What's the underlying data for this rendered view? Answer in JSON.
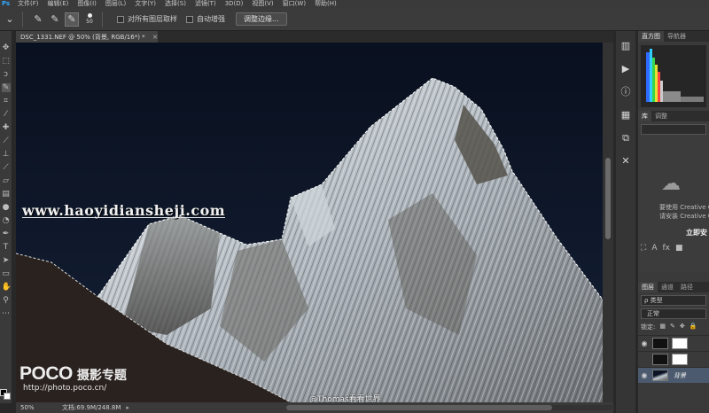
{
  "menubar": {
    "app_logo": "Ps",
    "items": [
      "文件(F)",
      "编辑(E)",
      "图像(I)",
      "图层(L)",
      "文字(Y)",
      "选择(S)",
      "滤镜(T)",
      "3D(D)",
      "视图(V)",
      "窗口(W)",
      "帮助(H)"
    ]
  },
  "options": {
    "brush_size": "50",
    "sample_all_layers": "对所有图层取样",
    "auto_enhance": "自动增强",
    "refine_edge": "调整边缘..."
  },
  "document": {
    "tab_title": "DSC_1331.NEF @ 50% (背景, RGB/16*) *",
    "close": "×"
  },
  "canvas": {
    "watermark_url": "www.haoyidiansheji.com",
    "logo_brand": "POCO",
    "logo_section": "摄影专题",
    "logo_url": "http://photo.poco.cn/",
    "credit": "@Thomas看看世界"
  },
  "status": {
    "zoom": "50%",
    "doc_size": "文档:69.9M/248.8M",
    "arrow": "▸"
  },
  "dock_icons": [
    "histogram-dock-icon",
    "play-icon",
    "info-icon",
    "brush-preset-icon",
    "clone-source-icon",
    "tool-preset-icon"
  ],
  "panels": {
    "top_tabs": [
      "直方图",
      "导航器"
    ],
    "library_tabs": [
      "库",
      "调整"
    ],
    "cc_line1": "要使用 Creative C",
    "cc_line2": "请安装 Creative C",
    "cc_link": "立即安",
    "layer_tabs": [
      "图层",
      "通道",
      "路径"
    ],
    "layer_filter": "ρ 类型",
    "blend_mode": "正常",
    "lock_label": "锁定:",
    "layers": [
      {
        "name": "",
        "type": "adjustment"
      },
      {
        "name": "",
        "type": "mask"
      },
      {
        "name": "背景",
        "type": "background"
      }
    ]
  },
  "colors": {
    "accent": "#31a8ff",
    "sky": "#0c1426",
    "panel": "#3a3a3a"
  }
}
